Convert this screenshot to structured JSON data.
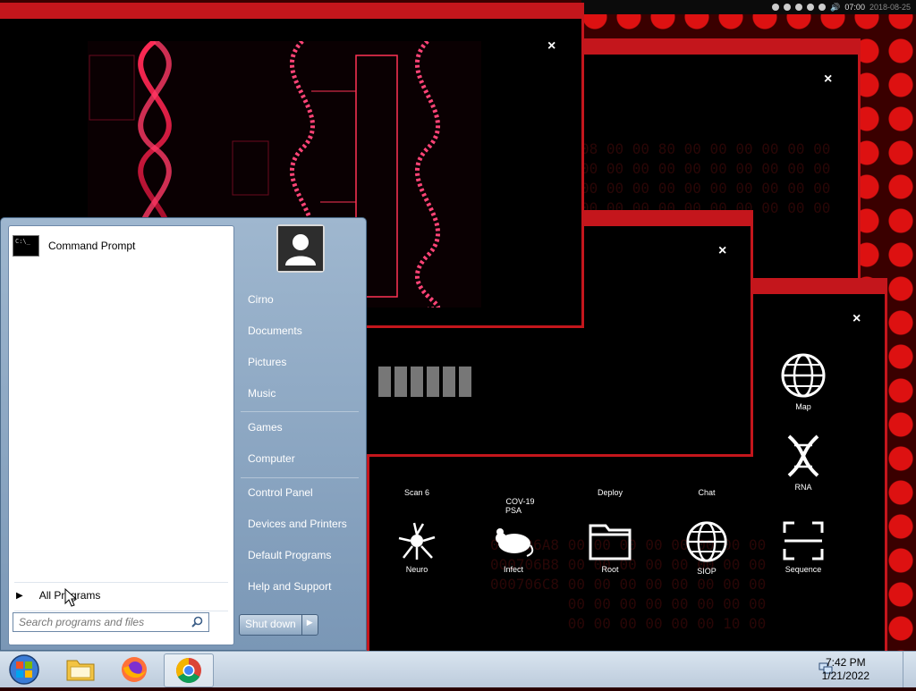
{
  "top_bar": {
    "clock": "07:00",
    "date": "2018-08-25"
  },
  "windows": {
    "dna_window": {
      "close_glyph": "×"
    },
    "hex_window": {
      "close_glyph": "×"
    },
    "loading_window": {
      "close_glyph": "×"
    },
    "apps_window": {
      "close_glyph": "×"
    }
  },
  "hex_background": "08 00 00 80 00 00 00 00 00 00\n00 00 00 00 00 00 00 00 00 00\n00 00 00 00 00 00 00 00 00 00\n00 00 00 00 00 00 00 00 00 00",
  "hex_lower": "000706A8 00 00 00 00 00 00 00 00\n000706B8 00 00 00 00 00 00 00 00\n000706C8 00 00 00 00 00 00 00 00\n         00 00 00 00 00 00 00 00\n         00 00 00 00 00 00 10 00",
  "apps": [
    {
      "label": "Map"
    },
    {
      "label": "Scan 6"
    },
    {
      "label": "COV-19\nPSA"
    },
    {
      "label": "Deploy"
    },
    {
      "label": "Chat"
    },
    {
      "label": "RNA"
    },
    {
      "label": "Neuro"
    },
    {
      "label": "Infect"
    },
    {
      "label": "Root"
    },
    {
      "label": "SIOP"
    },
    {
      "label": "Sequence"
    }
  ],
  "start_menu": {
    "pinned": [
      {
        "label": "Command Prompt",
        "icon": "command-prompt-icon"
      }
    ],
    "all_programs": "All Programs",
    "search_placeholder": "Search programs and files",
    "right": {
      "user": "Cirno",
      "items": [
        "Documents",
        "Pictures",
        "Music",
        "Games",
        "Computer",
        "Control Panel",
        "Devices and Printers",
        "Default Programs",
        "Help and Support"
      ]
    },
    "shutdown_label": "Shut down"
  },
  "taskbar": {
    "apps": [
      {
        "icon": "file-explorer-icon"
      },
      {
        "icon": "firefox-icon"
      },
      {
        "icon": "chrome-icon"
      }
    ],
    "time": "7:42 PM",
    "date": "1/21/2022"
  }
}
